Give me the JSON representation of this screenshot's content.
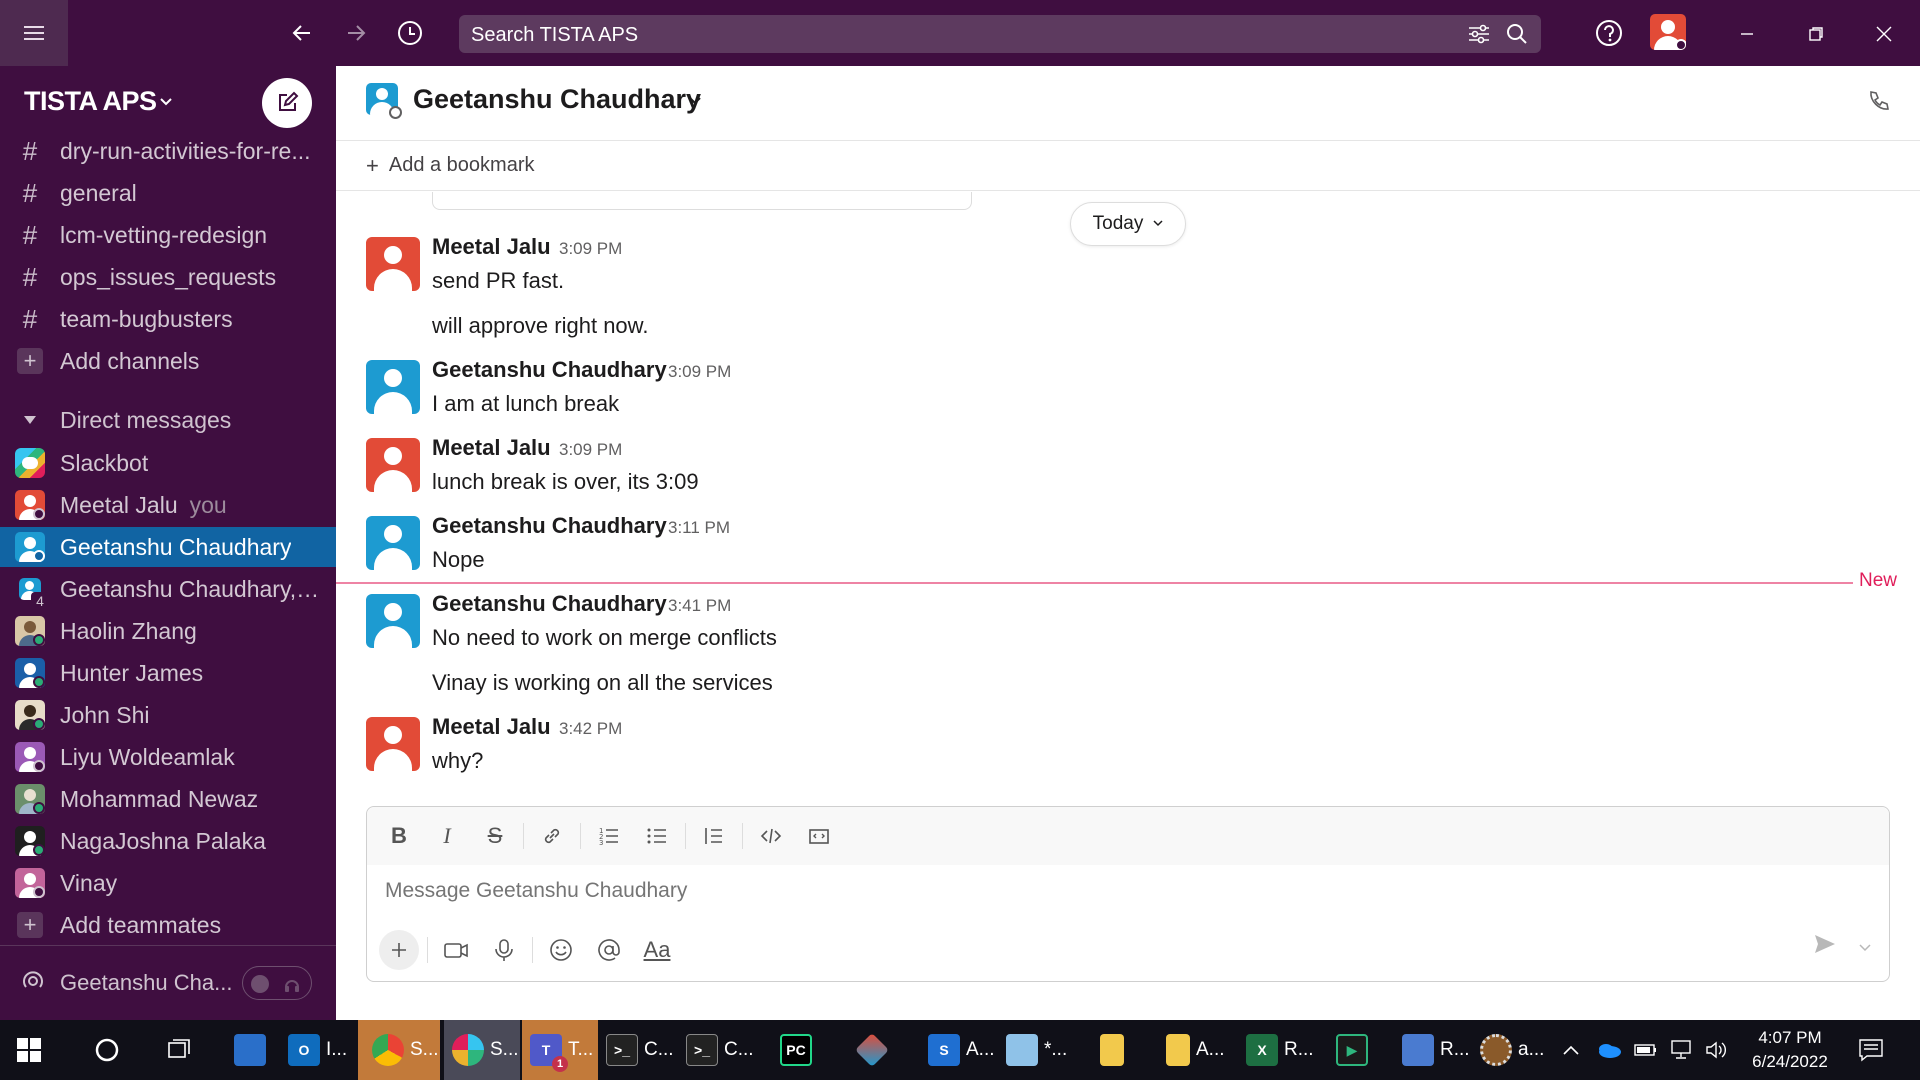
{
  "titlebar": {
    "search_placeholder": "Search TISTA APS"
  },
  "workspace": {
    "name": "TISTA APS"
  },
  "sidebar": {
    "channels": [
      {
        "label": "dry-run-activities-for-re..."
      },
      {
        "label": "general"
      },
      {
        "label": "lcm-vetting-redesign"
      },
      {
        "label": "ops_issues_requests"
      },
      {
        "label": "team-bugbusters"
      }
    ],
    "add_channels": "Add channels",
    "dm_header": "Direct messages",
    "dms": [
      {
        "label": "Slackbot",
        "suffix": ""
      },
      {
        "label": "Meetal Jalu",
        "suffix": "you"
      },
      {
        "label": "Geetanshu Chaudhary",
        "suffix": ""
      },
      {
        "label": "Geetanshu Chaudhary, ...",
        "suffix": ""
      },
      {
        "label": "Haolin Zhang",
        "suffix": ""
      },
      {
        "label": "Hunter James",
        "suffix": ""
      },
      {
        "label": "John Shi",
        "suffix": ""
      },
      {
        "label": "Liyu Woldeamlak",
        "suffix": ""
      },
      {
        "label": "Mohammad Newaz",
        "suffix": ""
      },
      {
        "label": "NagaJoshna Palaka",
        "suffix": ""
      },
      {
        "label": "Vinay",
        "suffix": ""
      }
    ],
    "add_teammates": "Add teammates",
    "group_dm_count": "4",
    "footer_name": "Geetanshu Cha..."
  },
  "channel": {
    "title": "Geetanshu Chaudhary",
    "add_bookmark": "Add a bookmark",
    "today_label": "Today",
    "new_label": "New"
  },
  "messages": [
    {
      "author": "Meetal Jalu",
      "time": "3:09 PM",
      "lines": [
        "send PR fast.",
        "will approve right now."
      ]
    },
    {
      "author": "Geetanshu Chaudhary",
      "time": "3:09 PM",
      "lines": [
        "I am at lunch break"
      ]
    },
    {
      "author": "Meetal Jalu",
      "time": "3:09 PM",
      "lines": [
        "lunch break is over, its 3:09"
      ]
    },
    {
      "author": "Geetanshu Chaudhary",
      "time": "3:11 PM",
      "lines": [
        "Nope"
      ]
    },
    {
      "author": "Geetanshu Chaudhary",
      "time": "3:41 PM",
      "lines": [
        "No need to work on merge conflicts",
        "Vinay is working on all the services"
      ]
    },
    {
      "author": "Meetal Jalu",
      "time": "3:42 PM",
      "lines": [
        "why?"
      ]
    }
  ],
  "composer": {
    "placeholder": "Message Geetanshu Chaudhary",
    "bold": "B",
    "italic": "I",
    "strike": "S",
    "text_format": "Aa"
  },
  "taskbar": {
    "apps": [
      {
        "label": "I..."
      },
      {
        "label": "S..."
      },
      {
        "label": "S..."
      },
      {
        "label": "T..."
      },
      {
        "label": "C..."
      },
      {
        "label": "C..."
      },
      {
        "label": "A..."
      },
      {
        "label": "*..."
      },
      {
        "label": "A..."
      },
      {
        "label": "R..."
      },
      {
        "label": "R..."
      },
      {
        "label": "a..."
      }
    ],
    "teams_badge": "1",
    "time": "4:07 PM",
    "date": "6/24/2022"
  },
  "colors": {
    "aubergine": "#3f0e40",
    "active_blue": "#1164a3",
    "avatar_red": "#e24b37",
    "avatar_blue": "#1d9bd1",
    "new_line": "#e01e5a"
  }
}
